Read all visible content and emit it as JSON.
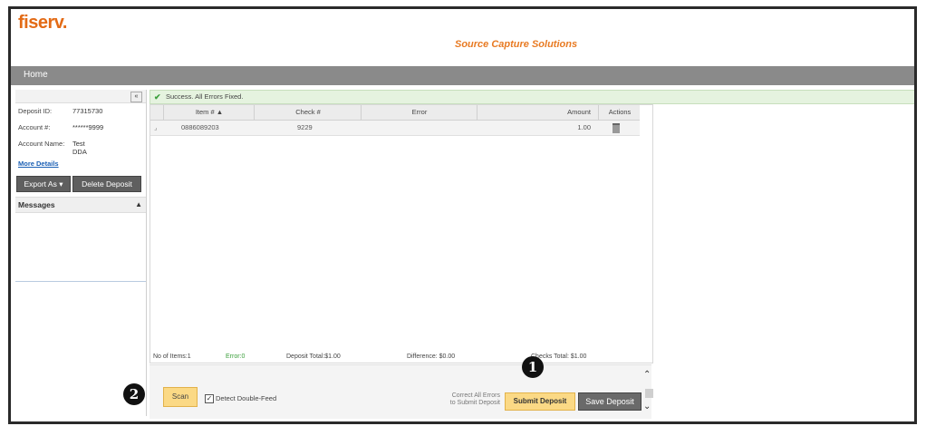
{
  "header": {
    "logo": "fiserv.",
    "app_title": "Source Capture Solutions"
  },
  "nav": {
    "home": "Home"
  },
  "sidebar": {
    "collapse_icon": "«",
    "deposit_id_label": "Deposit ID:",
    "deposit_id_value": "77315730",
    "account_label": "Account #:",
    "account_value": "******9999",
    "account_name_label": "Account Name:",
    "account_name_value": "Test DDA",
    "more_details": "More Details",
    "export_as": "Export As",
    "delete_deposit": "Delete Deposit",
    "messages": "Messages"
  },
  "status": {
    "message": "Success. All Errors Fixed."
  },
  "grid": {
    "columns": [
      "Item # ▲",
      "Check #",
      "Error",
      "Amount",
      "Actions"
    ],
    "rows": [
      {
        "item": "0886089203",
        "check": "9229",
        "error": "",
        "amount": "1.00"
      }
    ]
  },
  "summary": {
    "items": "No of Items:1",
    "errors": "Error:0",
    "deposit_total": "Deposit Total:$1.00",
    "difference": "Difference: $0.00",
    "checks_total": "Checks Total: $1.00"
  },
  "footer": {
    "scan": "Scan",
    "detect_double_feed": "Detect Double-Feed",
    "note_line1": "Correct All Errors",
    "note_line2": "to Submit Deposit",
    "submit": "Submit Deposit",
    "save": "Save Deposit"
  },
  "callouts": {
    "one": "1",
    "two": "2"
  },
  "colors": {
    "brand": "#e36b16",
    "nav": "#8a8a8a",
    "accent_button": "#fbd985",
    "success_bg": "#e5f3df",
    "error_count": "#3ca03c"
  }
}
